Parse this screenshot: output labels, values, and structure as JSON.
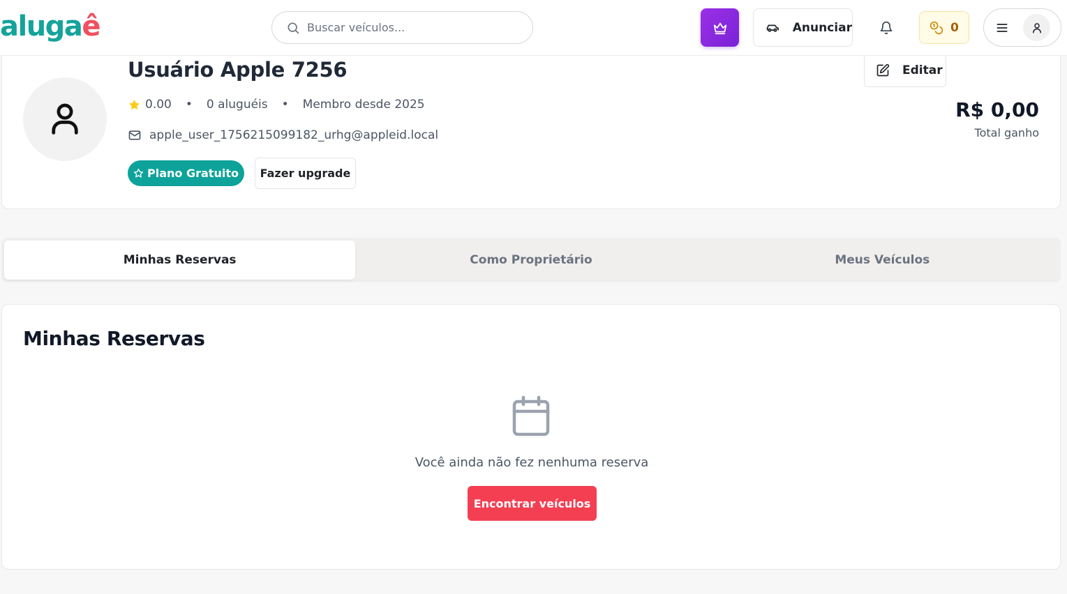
{
  "header": {
    "logo": {
      "part1": "aluga",
      "part2": "ê",
      "color_teal": "#14a39a",
      "color_coral": "#f0505f"
    },
    "search": {
      "placeholder": "Buscar veículos..."
    },
    "premium_button_icon": "crown-icon",
    "advertise_label": "Anunciar",
    "coins_count": "0",
    "accent_purple": "#8b2be2"
  },
  "profile": {
    "name": "Usuário Apple 7256",
    "rating": "0.00",
    "rentals": "0 aluguéis",
    "member_since": "Membro desde 2025",
    "email": "apple_user_1756215099182_urhg@appleid.local",
    "plan_label": "Plano Gratuito",
    "upgrade_label": "Fazer upgrade",
    "edit_label": "Editar",
    "earned_amount": "R$ 0,00",
    "earned_label": "Total ganho",
    "plan_color": "#0ea39a"
  },
  "tabs": [
    {
      "label": "Minhas Reservas",
      "active": true
    },
    {
      "label": "Como Proprietário",
      "active": false
    },
    {
      "label": "Meus Veículos",
      "active": false
    }
  ],
  "reservations": {
    "title": "Minhas Reservas",
    "empty_message": "Você ainda não fez nenhuma reserva",
    "cta_label": "Encontrar veículos",
    "cta_color": "#f43f52"
  }
}
